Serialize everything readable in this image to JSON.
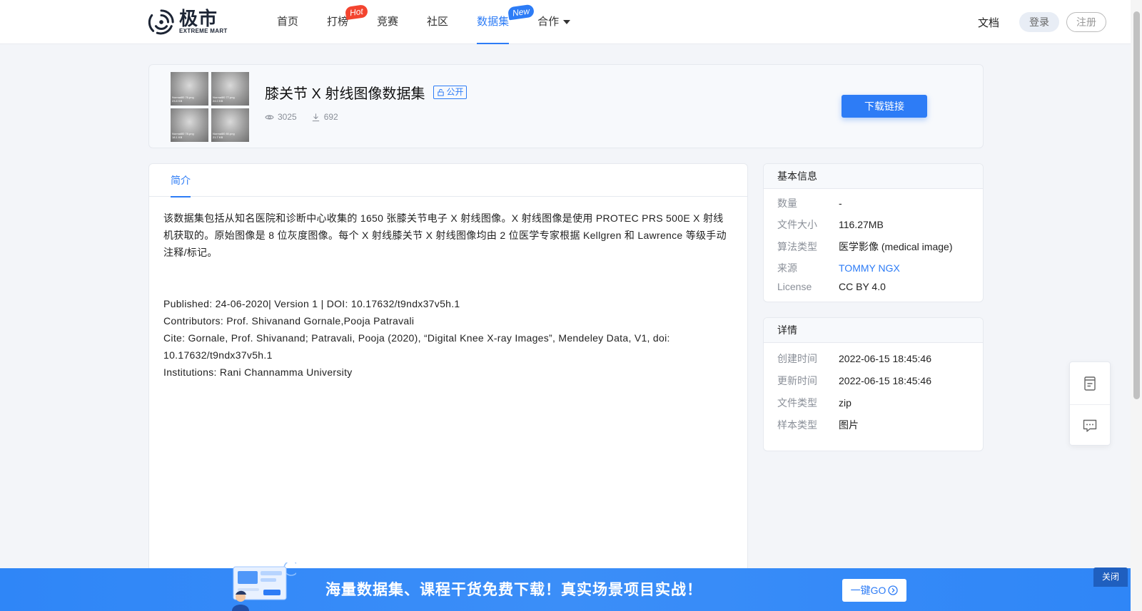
{
  "nav": {
    "logo_cn": "极市",
    "logo_en": "EXTREME MART",
    "items": [
      {
        "label": "首页"
      },
      {
        "label": "打榜",
        "badge": "Hot"
      },
      {
        "label": "竞赛"
      },
      {
        "label": "社区"
      },
      {
        "label": "数据集",
        "badge": "New",
        "active": true
      },
      {
        "label": "合作"
      }
    ],
    "docs": "文档",
    "login": "登录",
    "register": "注册"
  },
  "dataset": {
    "title": "膝关节 X 射线图像数据集",
    "visibility": "公开",
    "views": "3025",
    "downloads": "692",
    "download_button": "下载链接",
    "thumbnails": [
      {
        "label": "Normal80 76.png",
        "sub": "23.8 KB"
      },
      {
        "label": "Normal80 77.png",
        "sub": "24.0 KB"
      },
      {
        "label": "Normal80 78.png",
        "sub": "18.1 KB"
      },
      {
        "label": "Normal80 80.png",
        "sub": "21.7 KB"
      }
    ]
  },
  "tabs": {
    "intro": "简介"
  },
  "description": {
    "para1": "该数据集包括从知名医院和诊断中心收集的 1650 张膝关节电子 X 射线图像。X 射线图像是使用 PROTEC PRS 500E X 射线机获取的。原始图像是 8 位灰度图像。每个 X 射线膝关节 X 射线图像均由 2 位医学专家根据 Kellgren 和 Lawrence 等级手动注释/标记。",
    "published": "Published: 24-06-2020| Version 1 | DOI: 10.17632/t9ndx37v5h.1",
    "contributors": "Contributors: Prof. Shivanand Gornale,Pooja Patravali",
    "cite": "Cite: Gornale, Prof. Shivanand; Patravali, Pooja (2020), “Digital Knee X-ray Images”, Mendeley Data, V1, doi: 10.17632/t9ndx37v5h.1",
    "institutions": "Institutions: Rani Channamma University"
  },
  "basic_info": {
    "title": "基本信息",
    "rows": [
      {
        "k": "数量",
        "v": "-"
      },
      {
        "k": "文件大小",
        "v": "116.27MB"
      },
      {
        "k": "算法类型",
        "v": "医学影像 (medical image)"
      },
      {
        "k": "来源",
        "v": "TOMMY NGX"
      },
      {
        "k": "License",
        "v": "CC BY 4.0"
      }
    ]
  },
  "details": {
    "title": "详情",
    "rows": [
      {
        "k": "创建时间",
        "v": "2022-06-15 18:45:46"
      },
      {
        "k": "更新时间",
        "v": "2022-06-15 18:45:46"
      },
      {
        "k": "文件类型",
        "v": "zip"
      },
      {
        "k": "样本类型",
        "v": "图片"
      }
    ]
  },
  "banner": {
    "text": "海量数据集、课程干货免费下载！真实场景项目实战！",
    "go": "一键GO",
    "close": "关闭"
  },
  "colors": {
    "accent": "#2d7cf6",
    "hot": "#f3442f",
    "banner": "#2f86f7"
  }
}
